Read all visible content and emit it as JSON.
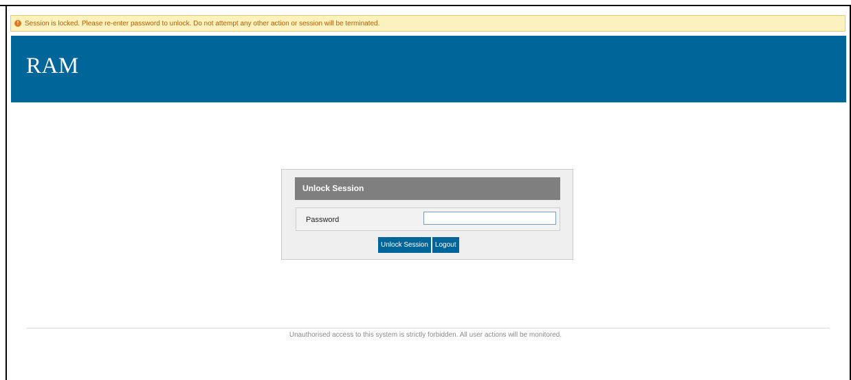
{
  "alert": {
    "icon": "warning-icon",
    "message": "Session is locked. Please re-enter password to unlock. Do not attempt any other action or session will be terminated."
  },
  "header": {
    "title": "RAM",
    "color": "#006699"
  },
  "unlock_panel": {
    "title": "Unlock Session",
    "password_label": "Password",
    "password_value": "",
    "unlock_button": "Unlock Session",
    "logout_button": "Logout"
  },
  "footer": {
    "notice": "Unauthorised access to this system is strictly forbidden. All user actions will be monitored."
  }
}
